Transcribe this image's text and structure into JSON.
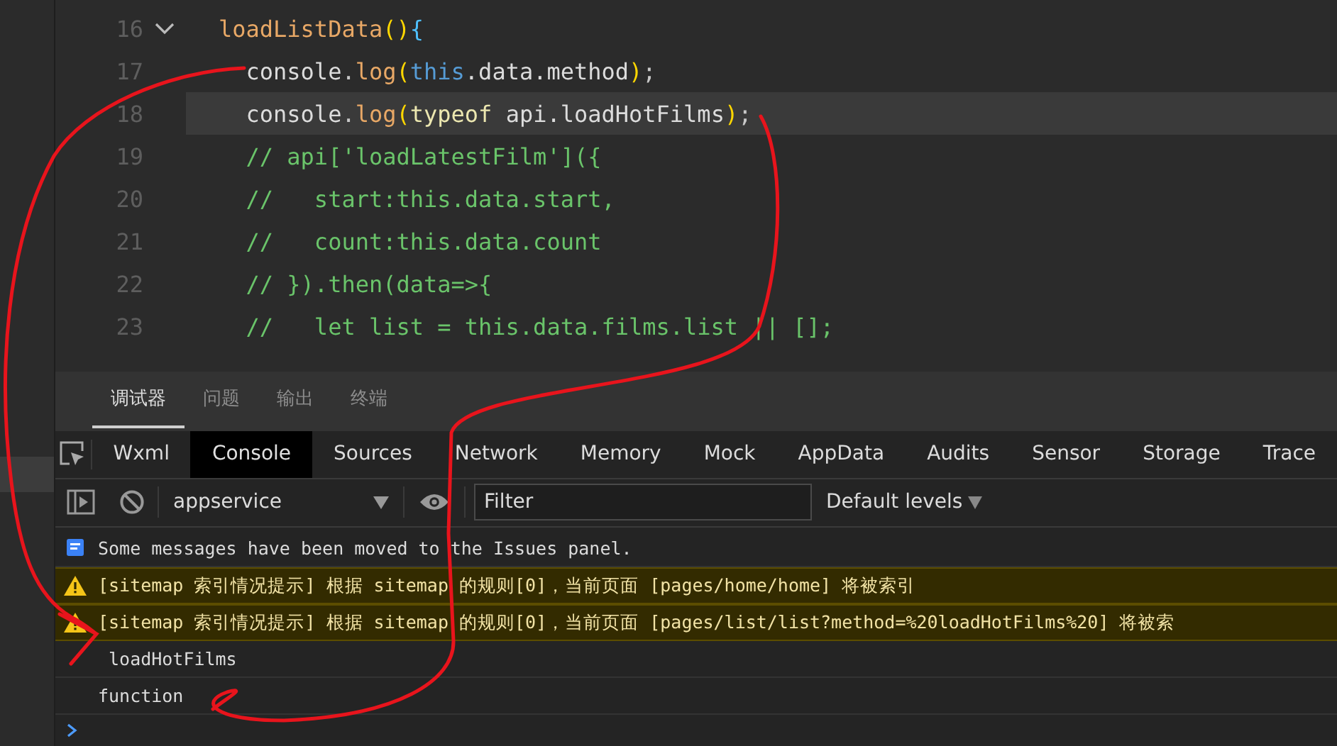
{
  "editor": {
    "lines": [
      {
        "number": "16",
        "kind": "block_start",
        "current": false,
        "tokens": [
          {
            "kind": "fn",
            "text": "loadListData"
          },
          {
            "kind": "paren",
            "text": "()"
          },
          {
            "kind": "brace",
            "text": "{"
          }
        ]
      },
      {
        "number": "17",
        "kind": "line",
        "current": false,
        "tokens": [
          {
            "kind": "plain",
            "text": "  console"
          },
          {
            "kind": "punct",
            "text": "."
          },
          {
            "kind": "fn",
            "text": "log"
          },
          {
            "kind": "paren",
            "text": "("
          },
          {
            "kind": "keyword",
            "text": "this"
          },
          {
            "kind": "plain",
            "text": ".data.method"
          },
          {
            "kind": "paren",
            "text": ")"
          },
          {
            "kind": "punct",
            "text": ";"
          }
        ]
      },
      {
        "number": "18",
        "kind": "line",
        "current": true,
        "tokens": [
          {
            "kind": "plain",
            "text": "  console"
          },
          {
            "kind": "punct",
            "text": "."
          },
          {
            "kind": "fn",
            "text": "log"
          },
          {
            "kind": "paren",
            "text": "("
          },
          {
            "kind": "operator",
            "text": "typeof"
          },
          {
            "kind": "plain",
            "text": " api.loadHotFilms"
          },
          {
            "kind": "paren",
            "text": ")"
          },
          {
            "kind": "punct",
            "text": ";"
          }
        ]
      },
      {
        "number": "19",
        "kind": "line",
        "current": false,
        "tokens": [
          {
            "kind": "comment",
            "text": "  // api['loadLatestFilm']({"
          }
        ]
      },
      {
        "number": "20",
        "kind": "line",
        "current": false,
        "tokens": [
          {
            "kind": "comment",
            "text": "  //   start:this.data.start,"
          }
        ]
      },
      {
        "number": "21",
        "kind": "line",
        "current": false,
        "tokens": [
          {
            "kind": "comment",
            "text": "  //   count:this.data.count"
          }
        ]
      },
      {
        "number": "22",
        "kind": "line",
        "current": false,
        "tokens": [
          {
            "kind": "comment",
            "text": "  // }).then(data=>{"
          }
        ]
      },
      {
        "number": "23",
        "kind": "line",
        "current": false,
        "tokens": [
          {
            "kind": "comment",
            "text": "  //   let list = this.data.films.list || [];"
          }
        ]
      }
    ]
  },
  "panel_tabs": [
    {
      "label": "调试器",
      "selected": true
    },
    {
      "label": "问题",
      "selected": false
    },
    {
      "label": "输出",
      "selected": false
    },
    {
      "label": "终端",
      "selected": false
    }
  ],
  "devtools_tabs": [
    {
      "label": "Wxml",
      "selected": false
    },
    {
      "label": "Console",
      "selected": true
    },
    {
      "label": "Sources",
      "selected": false
    },
    {
      "label": "Network",
      "selected": false
    },
    {
      "label": "Memory",
      "selected": false
    },
    {
      "label": "Mock",
      "selected": false
    },
    {
      "label": "AppData",
      "selected": false
    },
    {
      "label": "Audits",
      "selected": false
    },
    {
      "label": "Sensor",
      "selected": false
    },
    {
      "label": "Storage",
      "selected": false
    },
    {
      "label": "Trace",
      "selected": false
    }
  ],
  "toolbar": {
    "context": "appservice",
    "filter_placeholder": "Filter",
    "levels": "Default levels"
  },
  "console": [
    {
      "kind": "info",
      "text": "Some messages have been moved to the Issues panel."
    },
    {
      "kind": "warning",
      "text": "[sitemap 索引情况提示] 根据 sitemap 的规则[0]，当前页面 [pages/home/home] 将被索引"
    },
    {
      "kind": "warning",
      "text": "[sitemap 索引情况提示] 根据 sitemap 的规则[0]，当前页面 [pages/list/list?method=%20loadHotFilms%20] 将被索"
    },
    {
      "kind": "log",
      "text": " loadHotFilms"
    },
    {
      "kind": "log",
      "text": "function"
    }
  ]
}
